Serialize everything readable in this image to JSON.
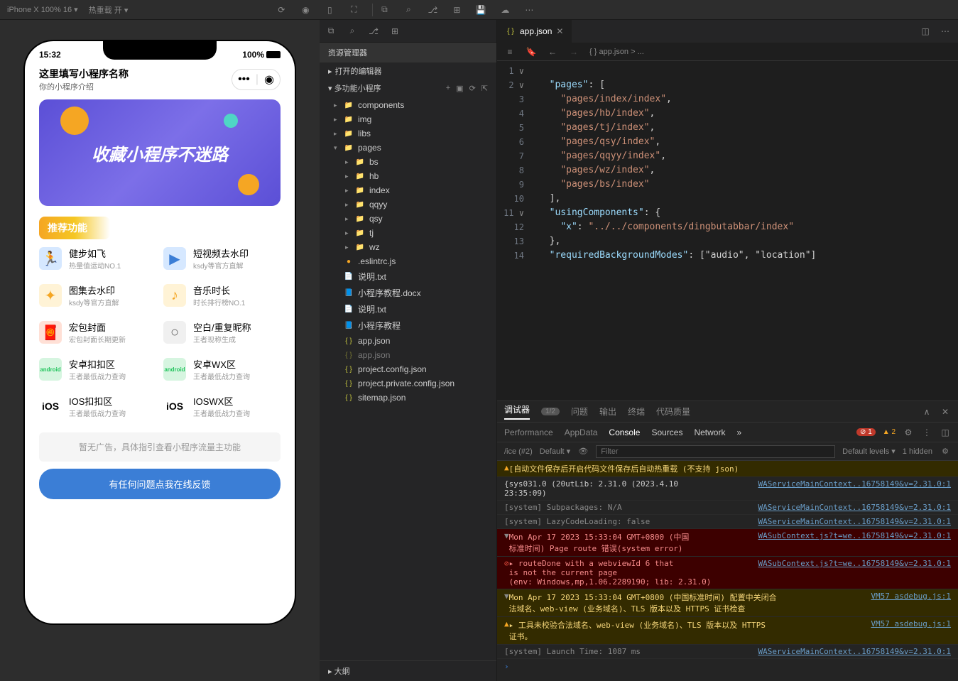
{
  "toolbar": {
    "device": "iPhone X 100% 16 ▾",
    "hotreload": "热重载 开 ▾"
  },
  "simulator": {
    "time": "15:32",
    "signal": "100%",
    "appTitle": "这里填写小程序名称",
    "appSub": "你的小程序介绍",
    "bannerText": "收藏小程序不迷路",
    "recommendHeader": "推荐功能",
    "features": [
      {
        "title": "健步如飞",
        "sub": "热量值运动NO.1",
        "iconClass": "gi-blue",
        "icon": "🏃"
      },
      {
        "title": "短视频去水印",
        "sub": "ksdy等官方直解",
        "iconClass": "gi-blue",
        "icon": "▶"
      },
      {
        "title": "图集去水印",
        "sub": "ksdy等官方直解",
        "iconClass": "gi-yellow",
        "icon": "✦"
      },
      {
        "title": "音乐时长",
        "sub": "时长排行榜NO.1",
        "iconClass": "gi-yellow",
        "icon": "♪"
      },
      {
        "title": "宏包封面",
        "sub": "宏包封面长期更新",
        "iconClass": "gi-red",
        "icon": "🧧"
      },
      {
        "title": "空白/重复昵称",
        "sub": "王者现称生成",
        "iconClass": "gi-white",
        "icon": "○"
      },
      {
        "title": "安卓扣扣区",
        "sub": "王者最低战力查询",
        "iconClass": "gi-green",
        "icon": "android"
      },
      {
        "title": "安卓WX区",
        "sub": "王者最低战力查询",
        "iconClass": "gi-green",
        "icon": "android"
      },
      {
        "title": "IOS扣扣区",
        "sub": "王者最低战力查询",
        "iconClass": "gi-ios",
        "icon": "iOS"
      },
      {
        "title": "IOSWX区",
        "sub": "王者最低战力查询",
        "iconClass": "gi-ios",
        "icon": "iOS"
      }
    ],
    "adText": "暂无广告，具体指引查看小程序流量主功能",
    "feedbackText": "有任何问题点我在线反馈"
  },
  "explorer": {
    "title": "资源管理器",
    "openEditors": "打开的编辑器",
    "projectName": "多功能小程序",
    "outline": "大纲",
    "tree": [
      {
        "name": "components",
        "type": "folder",
        "indent": 1,
        "expanded": false
      },
      {
        "name": "img",
        "type": "folder",
        "indent": 1,
        "expanded": false
      },
      {
        "name": "libs",
        "type": "folder",
        "indent": 1,
        "expanded": false
      },
      {
        "name": "pages",
        "type": "folder",
        "indent": 1,
        "expanded": true
      },
      {
        "name": "bs",
        "type": "folder",
        "indent": 2,
        "expanded": false
      },
      {
        "name": "hb",
        "type": "folder",
        "indent": 2,
        "expanded": false
      },
      {
        "name": "index",
        "type": "folder",
        "indent": 2,
        "expanded": false
      },
      {
        "name": "qqyy",
        "type": "folder",
        "indent": 2,
        "expanded": false
      },
      {
        "name": "qsy",
        "type": "folder",
        "indent": 2,
        "expanded": false
      },
      {
        "name": "tj",
        "type": "folder",
        "indent": 2,
        "expanded": false
      },
      {
        "name": "wz",
        "type": "folder",
        "indent": 2,
        "expanded": false
      },
      {
        "name": ".eslintrc.js",
        "type": "js",
        "indent": 1
      },
      {
        "name": "说明.txt",
        "type": "txt",
        "indent": 1
      },
      {
        "name": "小程序教程.docx",
        "type": "docx",
        "indent": 1
      },
      {
        "name": "说明.txt",
        "type": "txt",
        "indent": 1
      },
      {
        "name": "小程序教程",
        "type": "docx",
        "indent": 1
      },
      {
        "name": "app.json",
        "type": "json",
        "indent": 1
      },
      {
        "name": "app.json",
        "type": "json",
        "indent": 1,
        "dim": true
      },
      {
        "name": "project.config.json",
        "type": "json",
        "indent": 1
      },
      {
        "name": "project.private.config.json",
        "type": "json",
        "indent": 1
      },
      {
        "name": "sitemap.json",
        "type": "json",
        "indent": 1
      }
    ]
  },
  "editor": {
    "tabName": "app.json",
    "breadcrumb": "{ } app.json > ...",
    "code": [
      {
        "n": 1,
        "fold": "∨"
      },
      {
        "n": 2,
        "fold": "∨",
        "t": "  \"pages\": ["
      },
      {
        "n": 3,
        "t": "    \"pages/index/index\","
      },
      {
        "n": 4,
        "t": "    \"pages/hb/index\","
      },
      {
        "n": 5,
        "t": "    \"pages/tj/index\","
      },
      {
        "n": 6,
        "t": "    \"pages/qsy/index\","
      },
      {
        "n": 7,
        "t": "    \"pages/qqyy/index\","
      },
      {
        "n": 8,
        "t": "    \"pages/wz/index\","
      },
      {
        "n": 9,
        "t": "    \"pages/bs/index\""
      },
      {
        "n": 10,
        "t": "  ],"
      },
      {
        "n": 11,
        "fold": "∨",
        "t": "  \"usingComponents\": {"
      },
      {
        "n": 12,
        "t": "    \"x\": \"../../components/dingbutabbar/index\""
      },
      {
        "n": 13,
        "t": "  },"
      },
      {
        "n": 14,
        "t": "  \"requiredBackgroundModes\": [\"audio\", \"location\"]"
      }
    ]
  },
  "devtools": {
    "tabs": [
      "调试器",
      "问题",
      "输出",
      "终端",
      "代码质量"
    ],
    "tabBadge": "1/2",
    "subtabs": [
      "Performance",
      "AppData",
      "Console",
      "Sources",
      "Network"
    ],
    "errCount": "1",
    "warnCount": "2",
    "filterContext": "/ice (#2)",
    "filterLevel": "Default levels ▾",
    "filterHidden": "1 hidden",
    "filterPlaceholder": "Filter",
    "logs": [
      {
        "type": "warn",
        "msg": "[自动文件保存后开启代码文件保存后自动热重载 (不支持 json)",
        "src": ""
      },
      {
        "type": "info",
        "msg": "{sys031.0 (20utLib: 2.31.0 (2023.4.10\n23:35:09)",
        "src": "WAServiceMainContext..16758149&v=2.31.0:1"
      },
      {
        "type": "sys",
        "msg": "[system] Subpackages: N/A",
        "src": "WAServiceMainContext..16758149&v=2.31.0:1"
      },
      {
        "type": "sys",
        "msg": "[system] LazyCodeLoading: false",
        "src": "WAServiceMainContext..16758149&v=2.31.0:1"
      },
      {
        "type": "error-group",
        "msg": "Mon Apr 17 2023 15:33:04 GMT+0800 (中国\n标准时间) Page route 错误(system error)",
        "src": "WASubContext.js?t=we..16758149&v=2.31.0:1"
      },
      {
        "type": "error",
        "msg": "▸ routeDone with a webviewId 6 that\n  is not the current page\n  (env: Windows,mp,1.06.2289190; lib: 2.31.0)",
        "src": "WASubContext.js?t=we..16758149&v=2.31.0:1"
      },
      {
        "type": "warn-group",
        "msg": "Mon Apr 17 2023 15:33:04 GMT+0800 (中国标准时间) 配置中关闭合\n 法域名、web-view (业务域名)、TLS 版本以及 HTTPS 证书检查",
        "src": "VM57 asdebug.js:1"
      },
      {
        "type": "warn",
        "msg": "▸ 工具未校验合法域名、web-view (业务域名)、TLS 版本以及 HTTPS\n  证书。",
        "src": "VM57 asdebug.js:1"
      },
      {
        "type": "sys",
        "msg": "[system] Launch Time: 1087 ms",
        "src": "WAServiceMainContext..16758149&v=2.31.0:1"
      }
    ]
  }
}
